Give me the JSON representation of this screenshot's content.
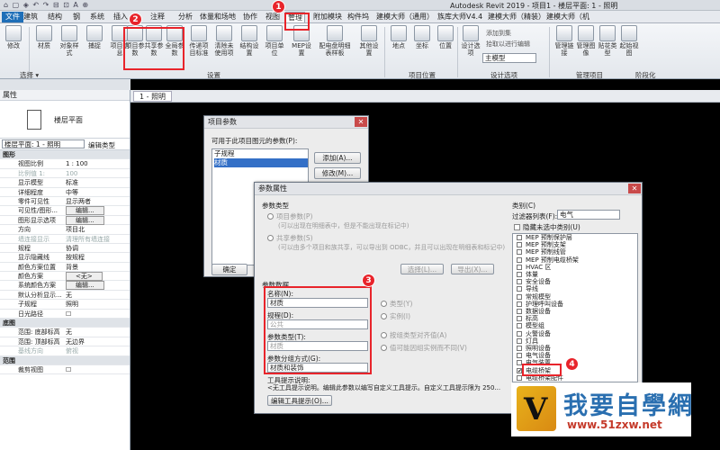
{
  "window": {
    "title": "Autodesk Revit 2019 - 项目1 - 楼层平面: 1 - 照明",
    "quick_access": "⌂ ▢ ◈ ↶ ↷ ⊟ ⊡ A ⊕"
  },
  "tabs": [
    "文件",
    "建筑",
    "结构",
    "钢",
    "系统",
    "插入",
    "注释",
    "分析",
    "体量和场地",
    "协作",
    "视图",
    "管理",
    "附加模块",
    "构件坞",
    "建模大师（通用）",
    "族库大师V4.4",
    "建模大师（精装）",
    "建模大师（机"
  ],
  "ribbon": {
    "buttons": [
      "修改",
      "材质",
      "对象样式",
      "捕捉",
      "项目信息",
      "项目参数",
      "共享参数",
      "全局参数",
      "传递项目标准",
      "清除未使用项",
      "结构设置",
      "项目单位",
      "MEP设置",
      "配电盘明细表样板",
      "其他设置",
      "地点",
      "坐标",
      "位置",
      "设计选项",
      "管理链接",
      "管理图像",
      "贴花类型",
      "起始视图"
    ],
    "side_items": [
      "添加到集",
      "拾取以进行编辑",
      "主模型"
    ],
    "groups": [
      "选择 ▾",
      "设置",
      "项目位置",
      "设计选项",
      "管理项目",
      "阶段化"
    ]
  },
  "annotations": {
    "n1": "1",
    "n2": "2",
    "n3": "3",
    "n4": "4"
  },
  "properties": {
    "header": "属性",
    "type_label": "楼层平面",
    "selector": "楼层平面: 1 - 照明",
    "edit_type": "编辑类型",
    "rows": [
      {
        "k": "图形",
        "v": "",
        "cat": true
      },
      {
        "k": "视图比例",
        "v": "1 : 100"
      },
      {
        "k": "比例值 1:",
        "v": "100",
        "dim": true
      },
      {
        "k": "显示模型",
        "v": "标准"
      },
      {
        "k": "详细程度",
        "v": "中等"
      },
      {
        "k": "零件可见性",
        "v": "显示两者"
      },
      {
        "k": "可见性/图形...",
        "v": "编辑...",
        "btn": true
      },
      {
        "k": "图形显示选项",
        "v": "编辑...",
        "btn": true
      },
      {
        "k": "方向",
        "v": "项目北"
      },
      {
        "k": "墙连接显示",
        "v": "清理所有墙连接",
        "dim": true
      },
      {
        "k": "规程",
        "v": "协调"
      },
      {
        "k": "显示隐藏线",
        "v": "按规程"
      },
      {
        "k": "颜色方案位置",
        "v": "背景"
      },
      {
        "k": "颜色方案",
        "v": "<无>",
        "btn": true
      },
      {
        "k": "系统颜色方案",
        "v": "编辑...",
        "btn": true
      },
      {
        "k": "默认分析显示...",
        "v": "无"
      },
      {
        "k": "子规程",
        "v": "照明"
      },
      {
        "k": "日光路径",
        "v": "☐"
      },
      {
        "k": "底图",
        "v": "",
        "cat": true
      },
      {
        "k": "范围: 底部标高",
        "v": "无"
      },
      {
        "k": "范围: 顶部标高",
        "v": "无边界"
      },
      {
        "k": "基线方向",
        "v": "俯视",
        "dim": true
      },
      {
        "k": "范围",
        "v": "",
        "cat": true
      },
      {
        "k": "裁剪视图",
        "v": "☐"
      }
    ]
  },
  "view_tab": "1 - 照明",
  "project_params": {
    "title": "项目参数",
    "available_label": "可用于此项目图元的参数(P):",
    "items": [
      "子规程",
      "材质"
    ],
    "add": "添加(A)...",
    "modify": "修改(M)...",
    "ok": "确定"
  },
  "param_props": {
    "title": "参数属性",
    "param_type_label": "参数类型",
    "project_param": "项目参数(P)",
    "project_param_desc": "(可以出现在明细表中，但是不能出现在标记中)",
    "shared_param": "共享参数(S)",
    "shared_param_desc": "(可以由多个项目和族共享，可以导出到 ODBC，并且可以出现在明细表和标记中)",
    "select": "选择(L)...",
    "export": "导出(X)...",
    "param_data": "参数数据",
    "name_label": "名称(N):",
    "name_value": "材质",
    "type_radio": "类型(Y)",
    "instance_radio": "实例(I)",
    "discipline_label": "规程(D):",
    "discipline_value": "公共",
    "param_type_label2": "参数类型(T):",
    "param_type_value": "材质",
    "align_by_type": "按组类型对齐值(A)",
    "vary_by_group": "值可能因组实例而不同(V)",
    "group_label": "参数分组方式(G):",
    "group_value": "材质和装饰",
    "tooltip_label": "工具提示说明:",
    "tooltip_text": "<无工具提示说明。编辑此参数以编写自定义工具提示。自定义工具提示限为 250...",
    "edit_tooltip": "编辑工具提示(O)...",
    "categories_label": "类别(C)",
    "filter_label": "过滤器列表(F):",
    "filter_value": "电气",
    "hide_unchecked": "隐藏未选中类别(U)",
    "categories": [
      "MEP 预制保护层",
      "MEP 预制支架",
      "MEP 预制线管",
      "MEP 预制电缆桥架",
      "HVAC 区",
      "体量",
      "安全设备",
      "导线",
      "常规模型",
      "护理呼叫设备",
      "数据设备",
      "标高",
      "模型组",
      "火警设备",
      "灯具",
      "照明设备",
      "电气设备",
      "电气装置",
      "电缆桥架",
      "电缆桥架配件"
    ],
    "checked_category": "电缆桥架"
  },
  "watermark": {
    "mark": "V",
    "title": "我要自學網",
    "url": "www.51zxw.net"
  }
}
